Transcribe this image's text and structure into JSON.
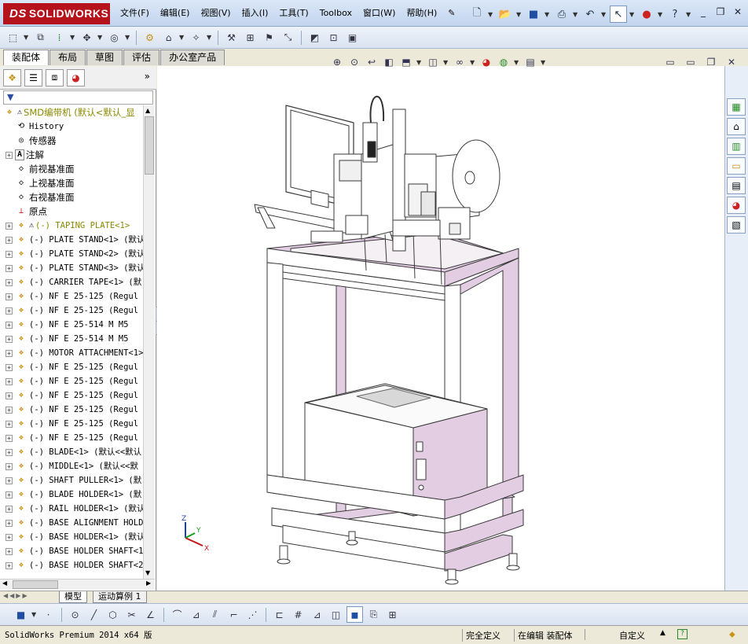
{
  "app": {
    "logo_prefix": "DS",
    "logo_text": "SOLIDWORKS"
  },
  "menus": [
    "文件(F)",
    "编辑(E)",
    "视图(V)",
    "插入(I)",
    "工具(T)",
    "Toolbox",
    "窗口(W)",
    "帮助(H)"
  ],
  "command_tabs": [
    "装配体",
    "布局",
    "草图",
    "评估",
    "办公室产品"
  ],
  "active_command_tab": "装配体",
  "feature_tree": {
    "root": "SMD编带机  (默认<默认_显",
    "items": [
      {
        "label": "History",
        "icon": "history-icon",
        "cn": false,
        "expandable": false
      },
      {
        "label": "传感器",
        "icon": "sensor-icon",
        "cn": true,
        "expandable": false
      },
      {
        "label": "注解",
        "icon": "annotation-icon",
        "cn": true,
        "expandable": true
      },
      {
        "label": "前视基准面",
        "icon": "plane-icon",
        "cn": true,
        "expandable": false
      },
      {
        "label": "上视基准面",
        "icon": "plane-icon",
        "cn": true,
        "expandable": false
      },
      {
        "label": "右视基准面",
        "icon": "plane-icon",
        "cn": true,
        "expandable": false
      },
      {
        "label": "原点",
        "icon": "origin-icon",
        "cn": true,
        "expandable": false
      },
      {
        "label": "(-) TAPING PLATE<1>",
        "icon": "subassembly-icon",
        "warn": true,
        "cn": false,
        "expandable": true,
        "color": "#8a8a00"
      },
      {
        "label": "(-) PLATE STAND<1> (默认",
        "icon": "part-icon",
        "cn": false,
        "expandable": true
      },
      {
        "label": "(-) PLATE STAND<2> (默认",
        "icon": "part-icon",
        "cn": false,
        "expandable": true
      },
      {
        "label": "(-) PLATE STAND<3> (默认",
        "icon": "part-icon",
        "cn": false,
        "expandable": true
      },
      {
        "label": "(-) CARRIER TAPE<1> (默",
        "icon": "part-icon",
        "cn": false,
        "expandable": true
      },
      {
        "label": "(-) NF E 25-125  (Regul",
        "icon": "part-icon",
        "cn": false,
        "expandable": true
      },
      {
        "label": "(-) NF E 25-125  (Regul",
        "icon": "part-icon",
        "cn": false,
        "expandable": true
      },
      {
        "label": "(-) NF E 25-514  M M5",
        "icon": "part-icon",
        "cn": false,
        "expandable": true
      },
      {
        "label": "(-) NF E 25-514  M M5",
        "icon": "part-icon",
        "cn": false,
        "expandable": true
      },
      {
        "label": "(-) MOTOR ATTACHMENT<1>",
        "icon": "part-icon",
        "cn": false,
        "expandable": true
      },
      {
        "label": "(-) NF E 25-125  (Regul",
        "icon": "part-icon",
        "cn": false,
        "expandable": true
      },
      {
        "label": "(-) NF E 25-125  (Regul",
        "icon": "part-icon",
        "cn": false,
        "expandable": true
      },
      {
        "label": "(-) NF E 25-125  (Regul",
        "icon": "part-icon",
        "cn": false,
        "expandable": true
      },
      {
        "label": "(-) NF E 25-125  (Regul",
        "icon": "part-icon",
        "cn": false,
        "expandable": true
      },
      {
        "label": "(-) NF E 25-125  (Regul",
        "icon": "part-icon",
        "cn": false,
        "expandable": true
      },
      {
        "label": "(-) NF E 25-125  (Regul",
        "icon": "part-icon",
        "cn": false,
        "expandable": true
      },
      {
        "label": "(-) BLADE<1> (默认<<默认",
        "icon": "part-icon",
        "cn": false,
        "expandable": true
      },
      {
        "label": "(-) MIDDLE<1> (默认<<默",
        "icon": "part-icon",
        "cn": false,
        "expandable": true
      },
      {
        "label": "(-) SHAFT PULLER<1> (默",
        "icon": "part-icon",
        "cn": false,
        "expandable": true
      },
      {
        "label": "(-) BLADE HOLDER<1> (默",
        "icon": "part-icon",
        "cn": false,
        "expandable": true
      },
      {
        "label": "(-) RAIL HOLDER<1> (默认",
        "icon": "part-icon",
        "cn": false,
        "expandable": true
      },
      {
        "label": "(-) BASE ALIGNMENT HOLD",
        "icon": "part-icon",
        "cn": false,
        "expandable": true
      },
      {
        "label": "(-) BASE HOLDER<1> (默认",
        "icon": "part-icon",
        "cn": false,
        "expandable": true
      },
      {
        "label": "(-) BASE HOLDER SHAFT<1",
        "icon": "part-icon",
        "cn": false,
        "expandable": true
      },
      {
        "label": "(-) BASE HOLDER SHAFT<2",
        "icon": "part-icon",
        "cn": false,
        "expandable": true
      }
    ]
  },
  "bottom_tabs": [
    "模型",
    "运动算例 1"
  ],
  "triad": {
    "x": "X",
    "y": "Y",
    "z": "Z"
  },
  "status": {
    "version": "SolidWorks Premium 2014 x64 版",
    "definition": "完全定义",
    "editing": "在编辑 装配体",
    "units": "自定义"
  },
  "colors": {
    "accent": "#b6121b",
    "frame_fill": "#e3cde3",
    "frame_stroke": "#444444"
  }
}
